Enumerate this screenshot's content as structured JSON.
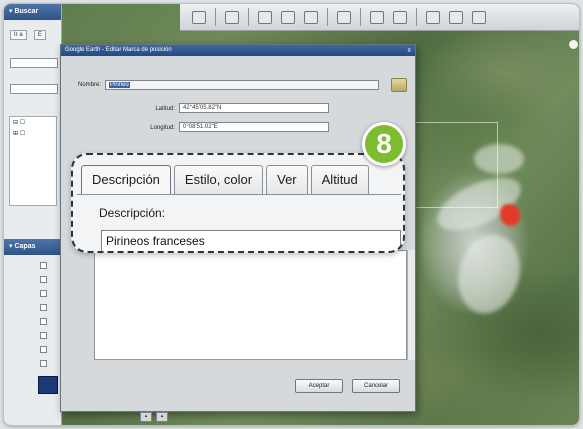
{
  "window": {
    "dialog_title": "Google Earth - Editar Marca de posición",
    "close_glyph": "x"
  },
  "sidebar": {
    "search_header": "Buscar",
    "layers_header": "Capas",
    "tab_1": "Ir a",
    "tab_2": "E"
  },
  "dialog": {
    "name_label": "Nombre:",
    "name_value": "Pirineo",
    "latitude_label": "Latitud:",
    "latitude_value": "42°45'05.82\"N",
    "longitude_label": "Longitud:",
    "longitude_value": "0°08'51.02\"E",
    "accept_label": "Aceptar",
    "cancel_label": "Cancelar"
  },
  "callout": {
    "tabs": [
      {
        "label": "Descripción",
        "active": true
      },
      {
        "label": "Estilo, color",
        "active": false
      },
      {
        "label": "Ver",
        "active": false
      },
      {
        "label": "Altitud",
        "active": false
      }
    ],
    "description_label": "Descripción:",
    "description_value": "Pirineos franceses"
  },
  "badge": {
    "step": "8",
    "color": "#7dbb2f"
  },
  "toolbar": {
    "icons": [
      "window-icon",
      "pointer-icon",
      "path-icon",
      "polygon-icon",
      "ruler-icon",
      "email-icon",
      "print-icon",
      "image-icon",
      "map-icon",
      "globe-icon"
    ]
  }
}
